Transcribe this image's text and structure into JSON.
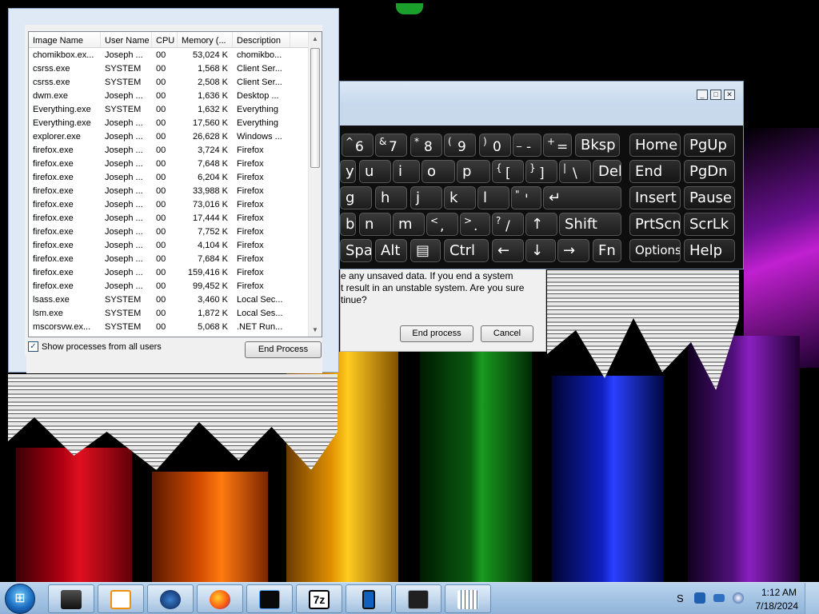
{
  "task_manager": {
    "columns": [
      "Image Name",
      "User Name",
      "CPU",
      "Memory (...",
      "Description"
    ],
    "processes": [
      {
        "name": "chomikbox.ex...",
        "user": "Joseph ...",
        "cpu": "00",
        "mem": "53,024 K",
        "desc": "chomikbo..."
      },
      {
        "name": "csrss.exe",
        "user": "SYSTEM",
        "cpu": "00",
        "mem": "1,568 K",
        "desc": "Client Ser..."
      },
      {
        "name": "csrss.exe",
        "user": "SYSTEM",
        "cpu": "00",
        "mem": "2,508 K",
        "desc": "Client Ser..."
      },
      {
        "name": "dwm.exe",
        "user": "Joseph ...",
        "cpu": "00",
        "mem": "1,636 K",
        "desc": "Desktop ..."
      },
      {
        "name": "Everything.exe",
        "user": "SYSTEM",
        "cpu": "00",
        "mem": "1,632 K",
        "desc": "Everything"
      },
      {
        "name": "Everything.exe",
        "user": "Joseph ...",
        "cpu": "00",
        "mem": "17,560 K",
        "desc": "Everything"
      },
      {
        "name": "explorer.exe",
        "user": "Joseph ...",
        "cpu": "00",
        "mem": "26,628 K",
        "desc": "Windows ..."
      },
      {
        "name": "firefox.exe",
        "user": "Joseph ...",
        "cpu": "00",
        "mem": "3,724 K",
        "desc": "Firefox"
      },
      {
        "name": "firefox.exe",
        "user": "Joseph ...",
        "cpu": "00",
        "mem": "7,648 K",
        "desc": "Firefox"
      },
      {
        "name": "firefox.exe",
        "user": "Joseph ...",
        "cpu": "00",
        "mem": "6,204 K",
        "desc": "Firefox"
      },
      {
        "name": "firefox.exe",
        "user": "Joseph ...",
        "cpu": "00",
        "mem": "33,988 K",
        "desc": "Firefox"
      },
      {
        "name": "firefox.exe",
        "user": "Joseph ...",
        "cpu": "00",
        "mem": "73,016 K",
        "desc": "Firefox"
      },
      {
        "name": "firefox.exe",
        "user": "Joseph ...",
        "cpu": "00",
        "mem": "17,444 K",
        "desc": "Firefox"
      },
      {
        "name": "firefox.exe",
        "user": "Joseph ...",
        "cpu": "00",
        "mem": "7,752 K",
        "desc": "Firefox"
      },
      {
        "name": "firefox.exe",
        "user": "Joseph ...",
        "cpu": "00",
        "mem": "4,104 K",
        "desc": "Firefox"
      },
      {
        "name": "firefox.exe",
        "user": "Joseph ...",
        "cpu": "00",
        "mem": "7,684 K",
        "desc": "Firefox"
      },
      {
        "name": "firefox.exe",
        "user": "Joseph ...",
        "cpu": "00",
        "mem": "159,416 K",
        "desc": "Firefox"
      },
      {
        "name": "firefox.exe",
        "user": "Joseph ...",
        "cpu": "00",
        "mem": "99,452 K",
        "desc": "Firefox"
      },
      {
        "name": "lsass.exe",
        "user": "SYSTEM",
        "cpu": "00",
        "mem": "3,460 K",
        "desc": "Local Sec..."
      },
      {
        "name": "lsm.exe",
        "user": "SYSTEM",
        "cpu": "00",
        "mem": "1,872 K",
        "desc": "Local Ses..."
      },
      {
        "name": "mscorsvw.ex...",
        "user": "SYSTEM",
        "cpu": "00",
        "mem": "5,068 K",
        "desc": ".NET Run..."
      }
    ],
    "show_all_label": "Show processes from all users",
    "show_all_checked": true,
    "end_process_label": "End Process"
  },
  "dialog": {
    "lines": [
      "e any unsaved data. If you end a system",
      "t result in an unstable system. Are you sure",
      "tinue?"
    ],
    "end_process_label": "End process",
    "cancel_label": "Cancel"
  },
  "keyboard": {
    "rows": [
      [
        {
          "sup": "^",
          "sub": "6"
        },
        {
          "sup": "&",
          "sub": "7"
        },
        {
          "sup": "*",
          "sub": "8"
        },
        {
          "sup": "(",
          "sub": "9"
        },
        {
          "sup": ")",
          "sub": "0"
        },
        {
          "sup": "_",
          "sub": "-"
        },
        {
          "sup": "+",
          "sub": "="
        },
        {
          "label": "Bksp"
        }
      ],
      [
        {
          "label": "y"
        },
        {
          "label": "u"
        },
        {
          "label": "i"
        },
        {
          "label": "o"
        },
        {
          "label": "p"
        },
        {
          "sup": "{",
          "sub": "["
        },
        {
          "sup": "}",
          "sub": "]"
        },
        {
          "sup": "|",
          "sub": "\\"
        },
        {
          "label": "Del"
        }
      ],
      [
        {
          "label": "g"
        },
        {
          "label": "h"
        },
        {
          "label": "j"
        },
        {
          "label": "k"
        },
        {
          "label": "l"
        },
        {
          "sup": ":",
          "sub": ";"
        },
        {
          "sup": "\"",
          "sub": "'"
        },
        {
          "label": "↵"
        }
      ],
      [
        {
          "label": "b"
        },
        {
          "label": "n"
        },
        {
          "label": "m"
        },
        {
          "sup": "<",
          "sub": ","
        },
        {
          "sup": ">",
          "sub": "."
        },
        {
          "sup": "?",
          "sub": "/"
        },
        {
          "label": "↑"
        },
        {
          "label": "Shift"
        }
      ],
      [
        {
          "label": "Space"
        },
        {
          "label": "Alt"
        },
        {
          "label": "▤"
        },
        {
          "label": "Ctrl"
        },
        {
          "label": "←"
        },
        {
          "label": "↓"
        },
        {
          "label": "→"
        },
        {
          "label": "Fn"
        }
      ]
    ],
    "nav_keys": [
      [
        "Home",
        "PgUp"
      ],
      [
        "End",
        "PgDn"
      ],
      [
        "Insert",
        "Pause"
      ],
      [
        "PrtScn",
        "ScrLk"
      ],
      [
        "Options",
        "Help"
      ]
    ]
  },
  "taskbar": {
    "apps": [
      "terminal-app",
      "media-player-app",
      "globe-app",
      "firefox-app",
      "monitor-app",
      "7zip-app",
      "tablet-app",
      "screen-app",
      "keyboard-app"
    ],
    "app_7zip_label": "7z",
    "tray_text": "S",
    "time": "1:12 AM",
    "date": "7/18/2024"
  },
  "colors": {
    "taskbar": "#a8c6e6",
    "keyboard_bg": "#0e0e0e",
    "key_text": "#ffffff"
  }
}
